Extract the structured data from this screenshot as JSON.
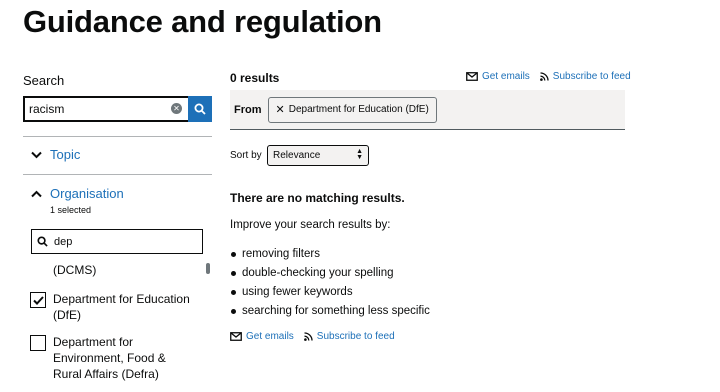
{
  "page": {
    "title": "Guidance and regulation"
  },
  "search": {
    "label": "Search",
    "value": "racism"
  },
  "facets": {
    "topic": {
      "label": "Topic"
    },
    "organisation": {
      "label": "Organisation",
      "selected_count": "1 selected",
      "filter_value": "dep",
      "options": [
        {
          "label": "(DCMS)",
          "checked": false
        },
        {
          "label": "Department for Education (DfE)",
          "checked": true
        },
        {
          "label": "Department for Environment, Food & Rural Affairs (Defra)",
          "checked": false
        }
      ]
    }
  },
  "results": {
    "count_text": "0 results",
    "get_emails": "Get emails",
    "subscribe_feed": "Subscribe to feed",
    "from_label": "From",
    "active_filter": "Department for Education (DfE)",
    "sort_label": "Sort by",
    "sort_value": "Relevance",
    "no_results_heading": "There are no matching results.",
    "improve_text": "Improve your search results by:",
    "suggestions": [
      "removing filters",
      "double-checking your spelling",
      "using fewer keywords",
      "searching for something less specific"
    ]
  },
  "colors": {
    "link": "#1d70b8",
    "text": "#0b0c0c",
    "panel": "#f3f2f1"
  }
}
